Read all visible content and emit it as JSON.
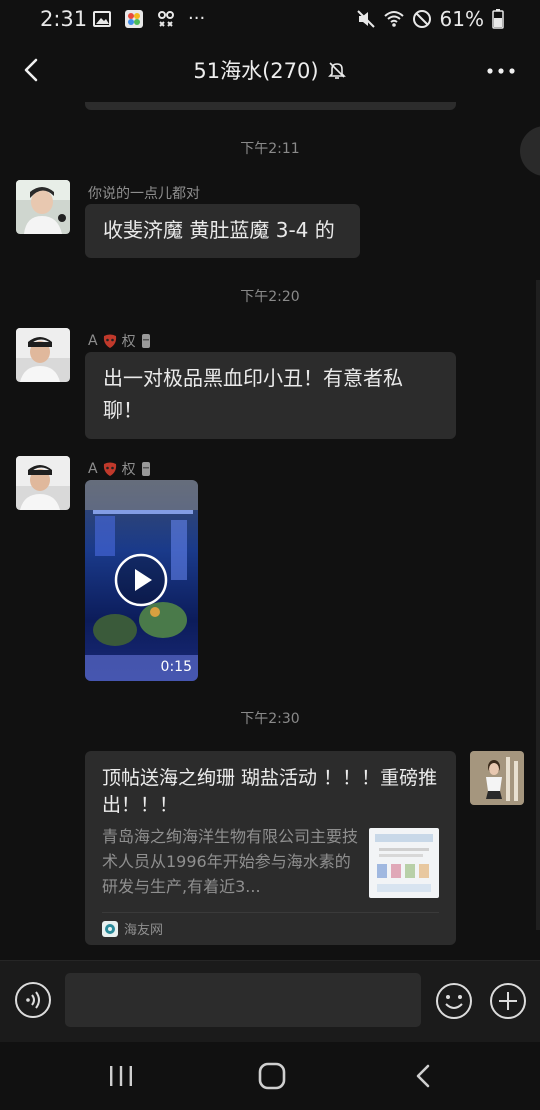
{
  "status_bar": {
    "time": "2:31",
    "extra_icons": "···",
    "battery": "61%"
  },
  "header": {
    "title": "51海水(270)"
  },
  "messages": [
    {
      "timestamp": "下午2:11",
      "sender": "你说的一点儿都对",
      "text": "收斐济魔 黄肚蓝魔 3-4 的"
    },
    {
      "timestamp": "下午2:20",
      "sender": "A",
      "sender_suffix": "权",
      "text": "出一对极品黑血印小丑！有意者私聊！"
    },
    {
      "sender": "A",
      "sender_suffix": "权",
      "video_duration": "0:15"
    },
    {
      "timestamp": "下午2:30",
      "card_title": "顶帖送海之绚珊 瑚盐活动 ！！！重磅推出！！！",
      "card_desc": "青岛海之绚海洋生物有限公司主要技术人员从1996年开始参与海水素的研发与生产,有着近3...",
      "card_source": "海友网"
    }
  ],
  "input": {
    "placeholder": "",
    "value": ""
  },
  "colors": {
    "background": "#111111",
    "bubble": "#2c2c2c",
    "muted_text": "#8a8a8a"
  },
  "icons": [
    "back-icon",
    "mute-icon",
    "more-icon",
    "voice-icon",
    "emoji-icon",
    "plus-icon",
    "play-icon",
    "recents-icon",
    "home-icon",
    "nav-back-icon"
  ]
}
